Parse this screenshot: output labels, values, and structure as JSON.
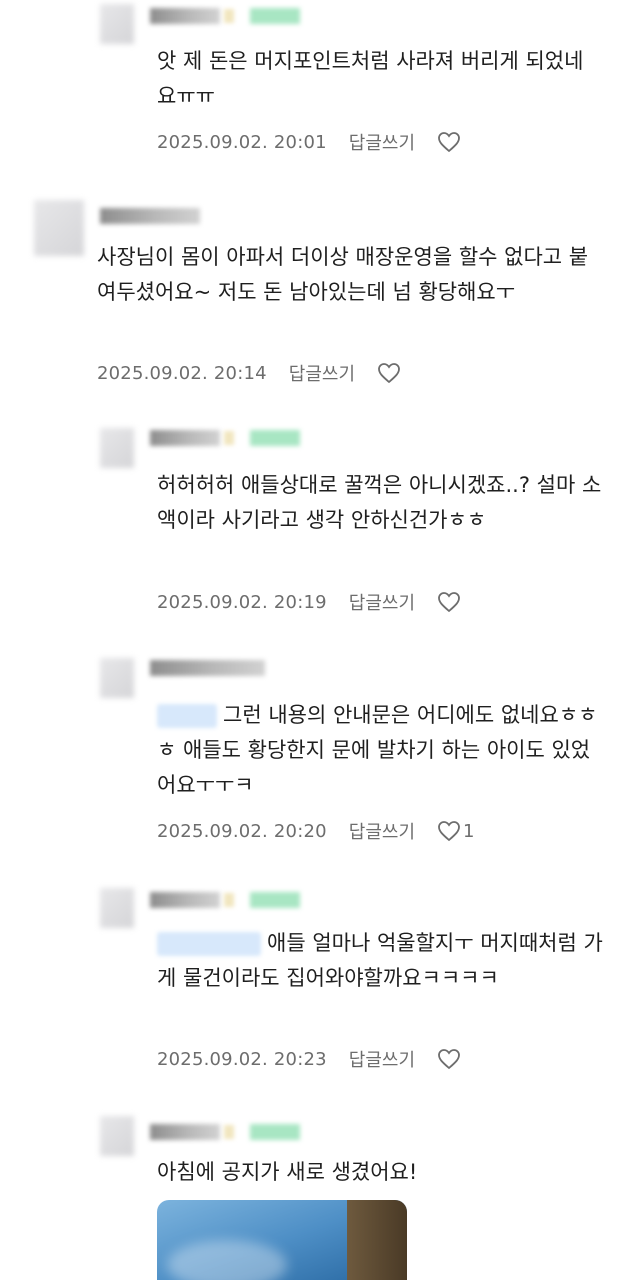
{
  "comments": [
    {
      "text": "앗 제 돈은 머지포인트처럼 사라져 버리게 되었네요ㅠㅠ",
      "date": "2025.09.02. 20:01",
      "reply": "답글쓰기"
    },
    {
      "text": "사장님이 몸이 아파서 더이상 매장운영을 할수 없다고 붙여두셨어요~ 저도 돈 남아있는데 넘 황당해요ㅜ",
      "date": "2025.09.02. 20:14",
      "reply": "답글쓰기"
    },
    {
      "text": "허허허허 애들상대로 꿀꺽은 아니시겠죠..? 설마 소액이라 사기라고 생각 안하신건가ㅎㅎ",
      "date": "2025.09.02. 20:19",
      "reply": "답글쓰기"
    },
    {
      "text": "그런 내용의 안내문은 어디에도 없네요ㅎㅎㅎ 애들도 황당한지 문에 발차기 하는 아이도 있었어요ㅜㅜㅋ",
      "date": "2025.09.02. 20:20",
      "reply": "답글쓰기",
      "likes": "1"
    },
    {
      "text": "애들 얼마나 억울할지ㅜ 머지때처럼 가게 물건이라도 집어와야할까요ㅋㅋㅋㅋ",
      "date": "2025.09.02. 20:23",
      "reply": "답글쓰기"
    },
    {
      "text": "아침에 공지가 새로 생겼어요!"
    }
  ],
  "icons": {
    "like": "heart-outline-icon"
  },
  "colors": {
    "text": "#1f1f1f",
    "meta": "#6d6d6d",
    "mention_highlight": "#d7e8fb",
    "badge_green": "#a8e6c3"
  }
}
